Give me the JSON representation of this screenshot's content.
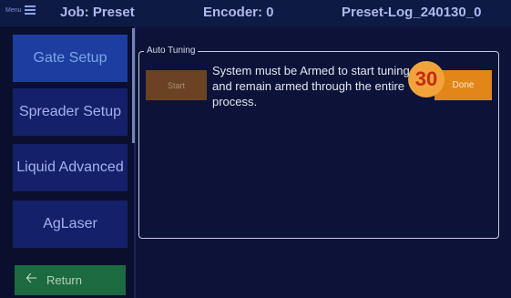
{
  "header": {
    "menu_label": "Menu",
    "job": "Job: Preset",
    "encoder": "Encoder: 0",
    "log_name": "Preset-Log_240130_0"
  },
  "sidebar": {
    "items": [
      {
        "label": "Gate Setup",
        "active": true
      },
      {
        "label": "Spreader Setup",
        "active": false
      },
      {
        "label": "Liquid Advanced",
        "active": false
      },
      {
        "label": "AgLaser",
        "active": false
      }
    ],
    "return_label": "Return"
  },
  "panel": {
    "legend": "Auto Tuning",
    "start_label": "Start",
    "done_label": "Done",
    "message": "System must be Armed to start tuning and remain armed through the entire process.",
    "countdown": "30"
  },
  "colors": {
    "background": "#0c1238",
    "accent_orange": "#e2861a",
    "return_green": "#1c6a3f",
    "nav_blue": "#15206a"
  }
}
